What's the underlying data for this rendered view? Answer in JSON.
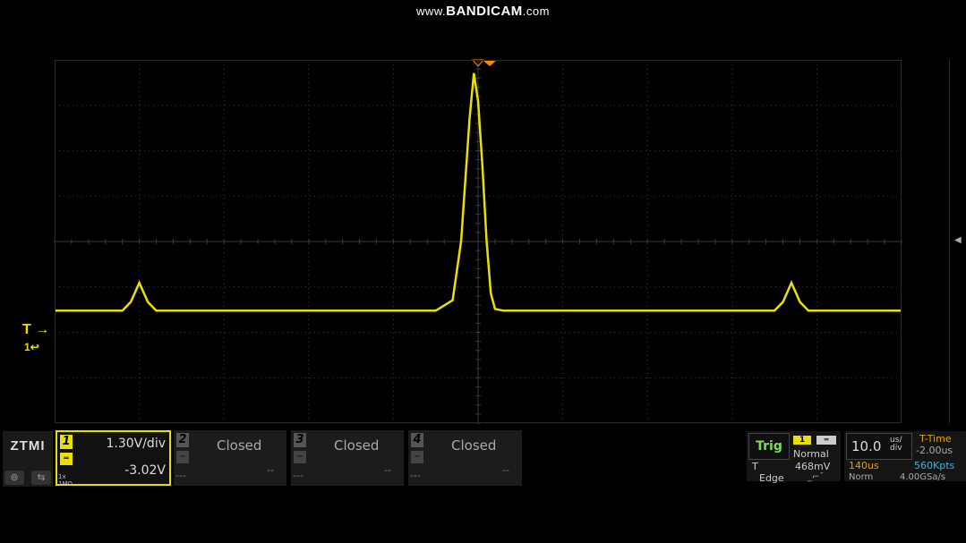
{
  "watermark": {
    "prefix": "www.",
    "brand": "BANDICAM",
    "suffix": ".com"
  },
  "markers": {
    "trigger": "T",
    "trigger_arrow": "→",
    "channel": "1"
  },
  "brand": {
    "logo": "ZTMI"
  },
  "channels": [
    {
      "number": "1",
      "scale": "1.30V/div",
      "offset": "-3.02V",
      "impedance_top": "1x",
      "impedance_bottom": "1MΩ",
      "color": "#e8e000",
      "state": "active"
    },
    {
      "number": "2",
      "status": "Closed",
      "value": "--",
      "placeholder": "---"
    },
    {
      "number": "3",
      "status": "Closed",
      "value": "--",
      "placeholder": "---"
    },
    {
      "number": "4",
      "status": "Closed",
      "value": "--",
      "placeholder": "---"
    }
  ],
  "trigger": {
    "label": "Trig",
    "source": "1",
    "mode": "Normal",
    "type_letter": "T",
    "level": "468mV",
    "type": "Edge"
  },
  "timebase": {
    "scale": "10.0",
    "unit_top": "us/",
    "unit_bottom": "div",
    "t_time_label": "T-Time",
    "t_time_value": "-2.00us",
    "range": "140us",
    "memory_depth": "560Kpts",
    "acq_mode": "Norm",
    "sample_rate": "4.00GSa/s"
  },
  "colors": {
    "trace": "#e8e000",
    "grid": "#3a3a3a",
    "trigger_marker": "#ff8c00",
    "trig_label": "#7ddc5a",
    "timebase_accent": "#e8a000",
    "memory_accent": "#3fb4d8"
  },
  "chart_data": {
    "type": "line",
    "title": "",
    "xlabel": "",
    "ylabel": "",
    "x_unit": "us",
    "y_unit": "V",
    "xlim": [
      -50,
      50
    ],
    "ylim": [
      -3.22,
      7.18
    ],
    "grid": true,
    "series": [
      {
        "x": [
          -50,
          -45,
          -42,
          -41,
          -40,
          -39,
          -38,
          -35,
          -20,
          -5,
          -3,
          -2,
          -1,
          -0.5,
          0,
          0.5,
          1,
          1.5,
          2,
          3,
          5,
          20,
          33,
          35,
          36,
          37,
          38,
          39,
          40,
          45,
          50
        ],
        "values": [
          0,
          0,
          0,
          0.25,
          0.8,
          0.25,
          0,
          0,
          0,
          0,
          0.3,
          2.0,
          5.5,
          6.8,
          6.0,
          4.2,
          2.0,
          0.5,
          0.05,
          0,
          0,
          0,
          0,
          0,
          0.25,
          0.8,
          0.25,
          0,
          0,
          0,
          0
        ]
      }
    ]
  }
}
